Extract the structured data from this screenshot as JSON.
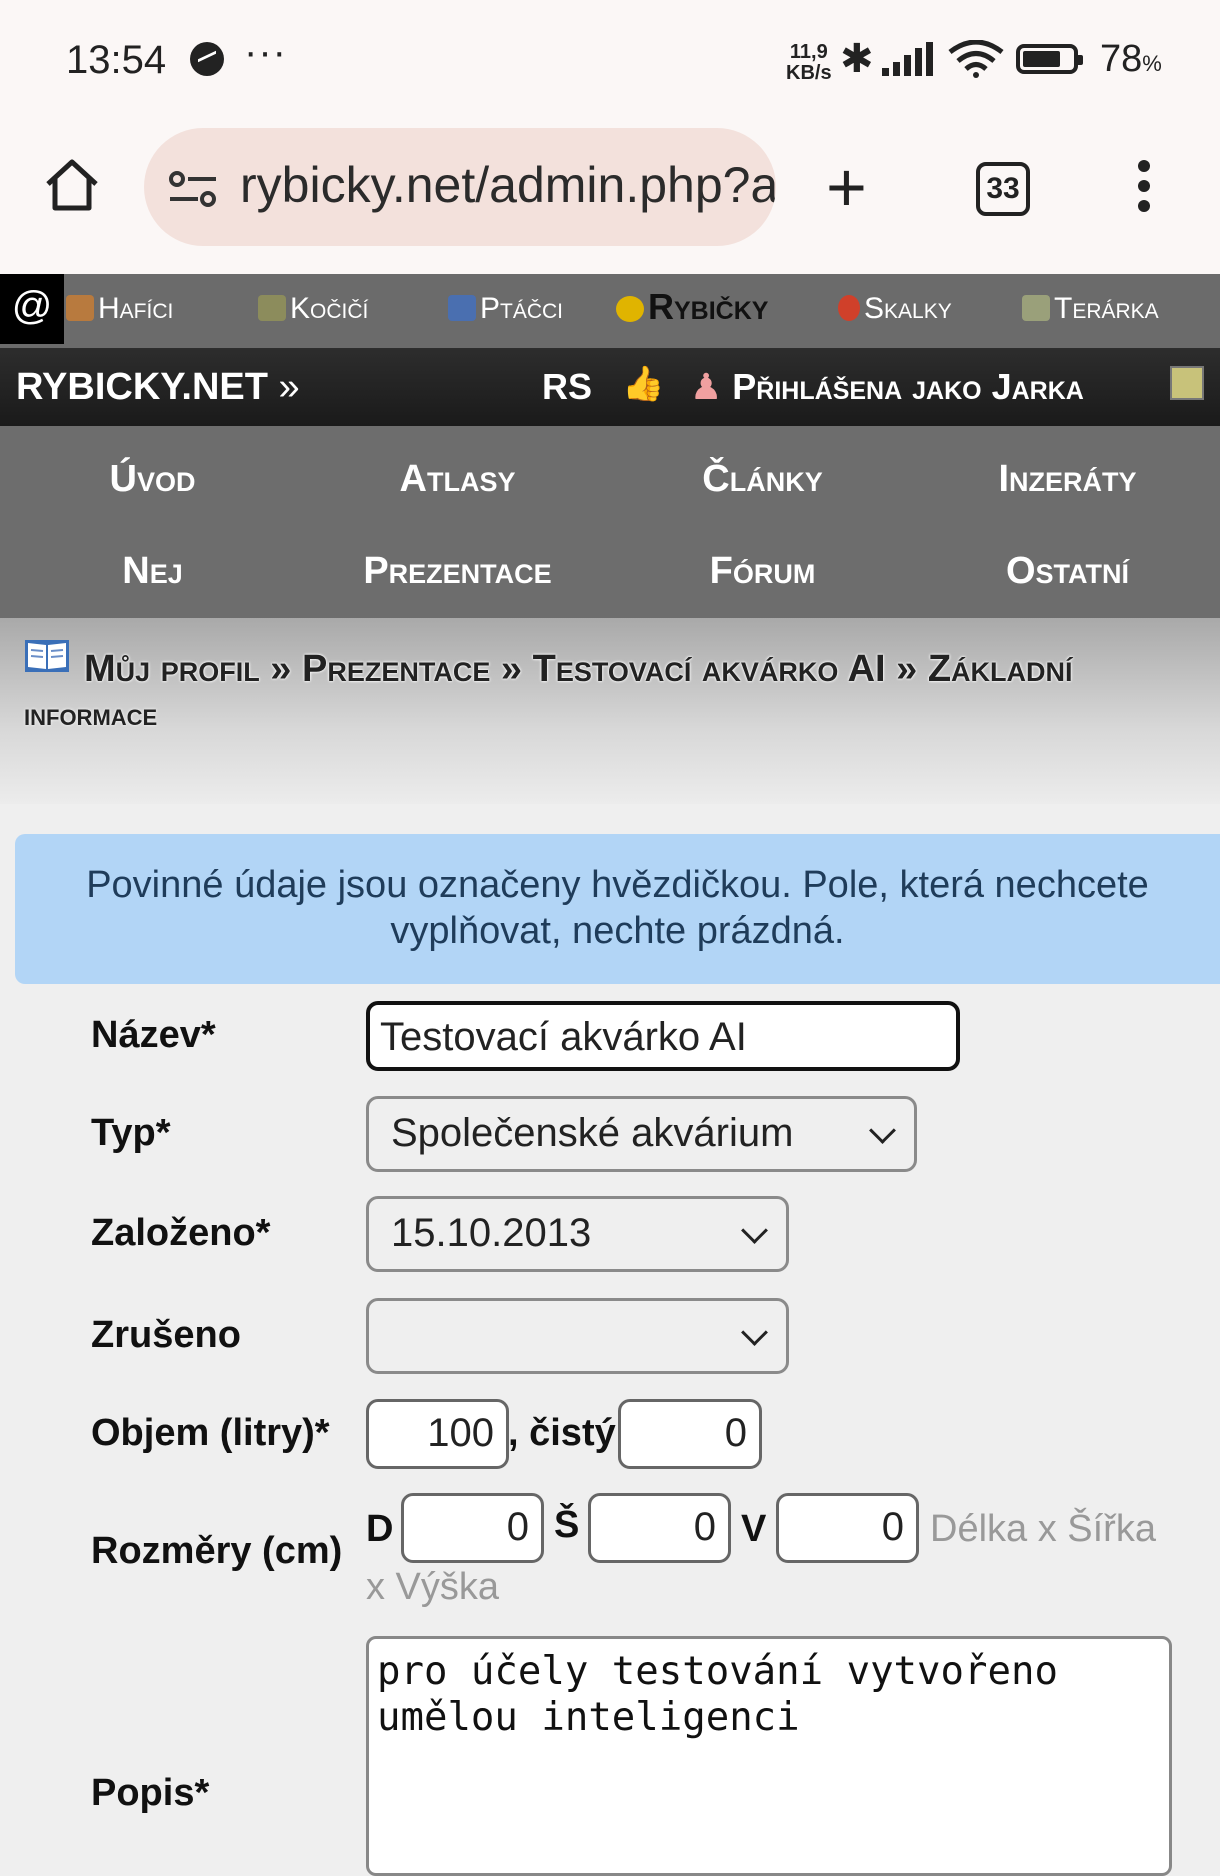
{
  "status_bar": {
    "time": "13:54",
    "speed_top": "11,9",
    "speed_bottom": "KB/s",
    "battery": "78",
    "battery_unit": "%"
  },
  "browser": {
    "url": "rybicky.net/admin.php?a",
    "tab_count": "33"
  },
  "sites": [
    {
      "label": "Hafíci",
      "color": "#b87a3e"
    },
    {
      "label": "Kočičí",
      "color": "#8c8c5c"
    },
    {
      "label": "Ptáčci",
      "color": "#4a6fb0"
    },
    {
      "label": "Rybičky",
      "color": "#e0b400"
    },
    {
      "label": "Skalky",
      "color": "#d0402a"
    },
    {
      "label": "Terárka",
      "color": "#9aa07a"
    }
  ],
  "header": {
    "brand": "RYBICKY.NET",
    "brand_sep": "»",
    "rs": "RS",
    "login": "Přihlášena jako Jarka"
  },
  "nav": {
    "row1": [
      "Úvod",
      "Atlasy",
      "Články",
      "Inzeráty"
    ],
    "row2": [
      "Nej",
      "Prezentace",
      "Fórum",
      "Ostatní"
    ]
  },
  "breadcrumb": {
    "items": [
      "Můj profil",
      "Prezentace",
      "Testovací akvárko AI",
      "Základní"
    ],
    "line2": "informace",
    "separator": "»"
  },
  "info": "Povinné údaje jsou označeny hvězdičkou. Pole, která nechcete vyplňovat, nechte prázdná.",
  "form": {
    "name_label": "Název*",
    "name_value": "Testovací akvárko AI",
    "type_label": "Typ*",
    "type_value": "Společenské akvárium",
    "founded_label": "Založeno*",
    "founded_value": "15.10.2013",
    "closed_label": "Zrušeno",
    "closed_value": "",
    "volume_label": "Objem (litry)*",
    "volume_value": "100",
    "clean_label": ", čistý",
    "clean_value": "0",
    "dims_label": "Rozměry (cm)",
    "d_label": "D",
    "d_value": "0",
    "s_label": "Š",
    "s_value": "0",
    "v_label": "V",
    "v_value": "0",
    "dims_hint_1": "Délka x Šířka",
    "dims_hint_2": "x Výška",
    "desc_label": "Popis*",
    "desc_value": "pro účely testování vytvořeno umělou inteligenci"
  }
}
